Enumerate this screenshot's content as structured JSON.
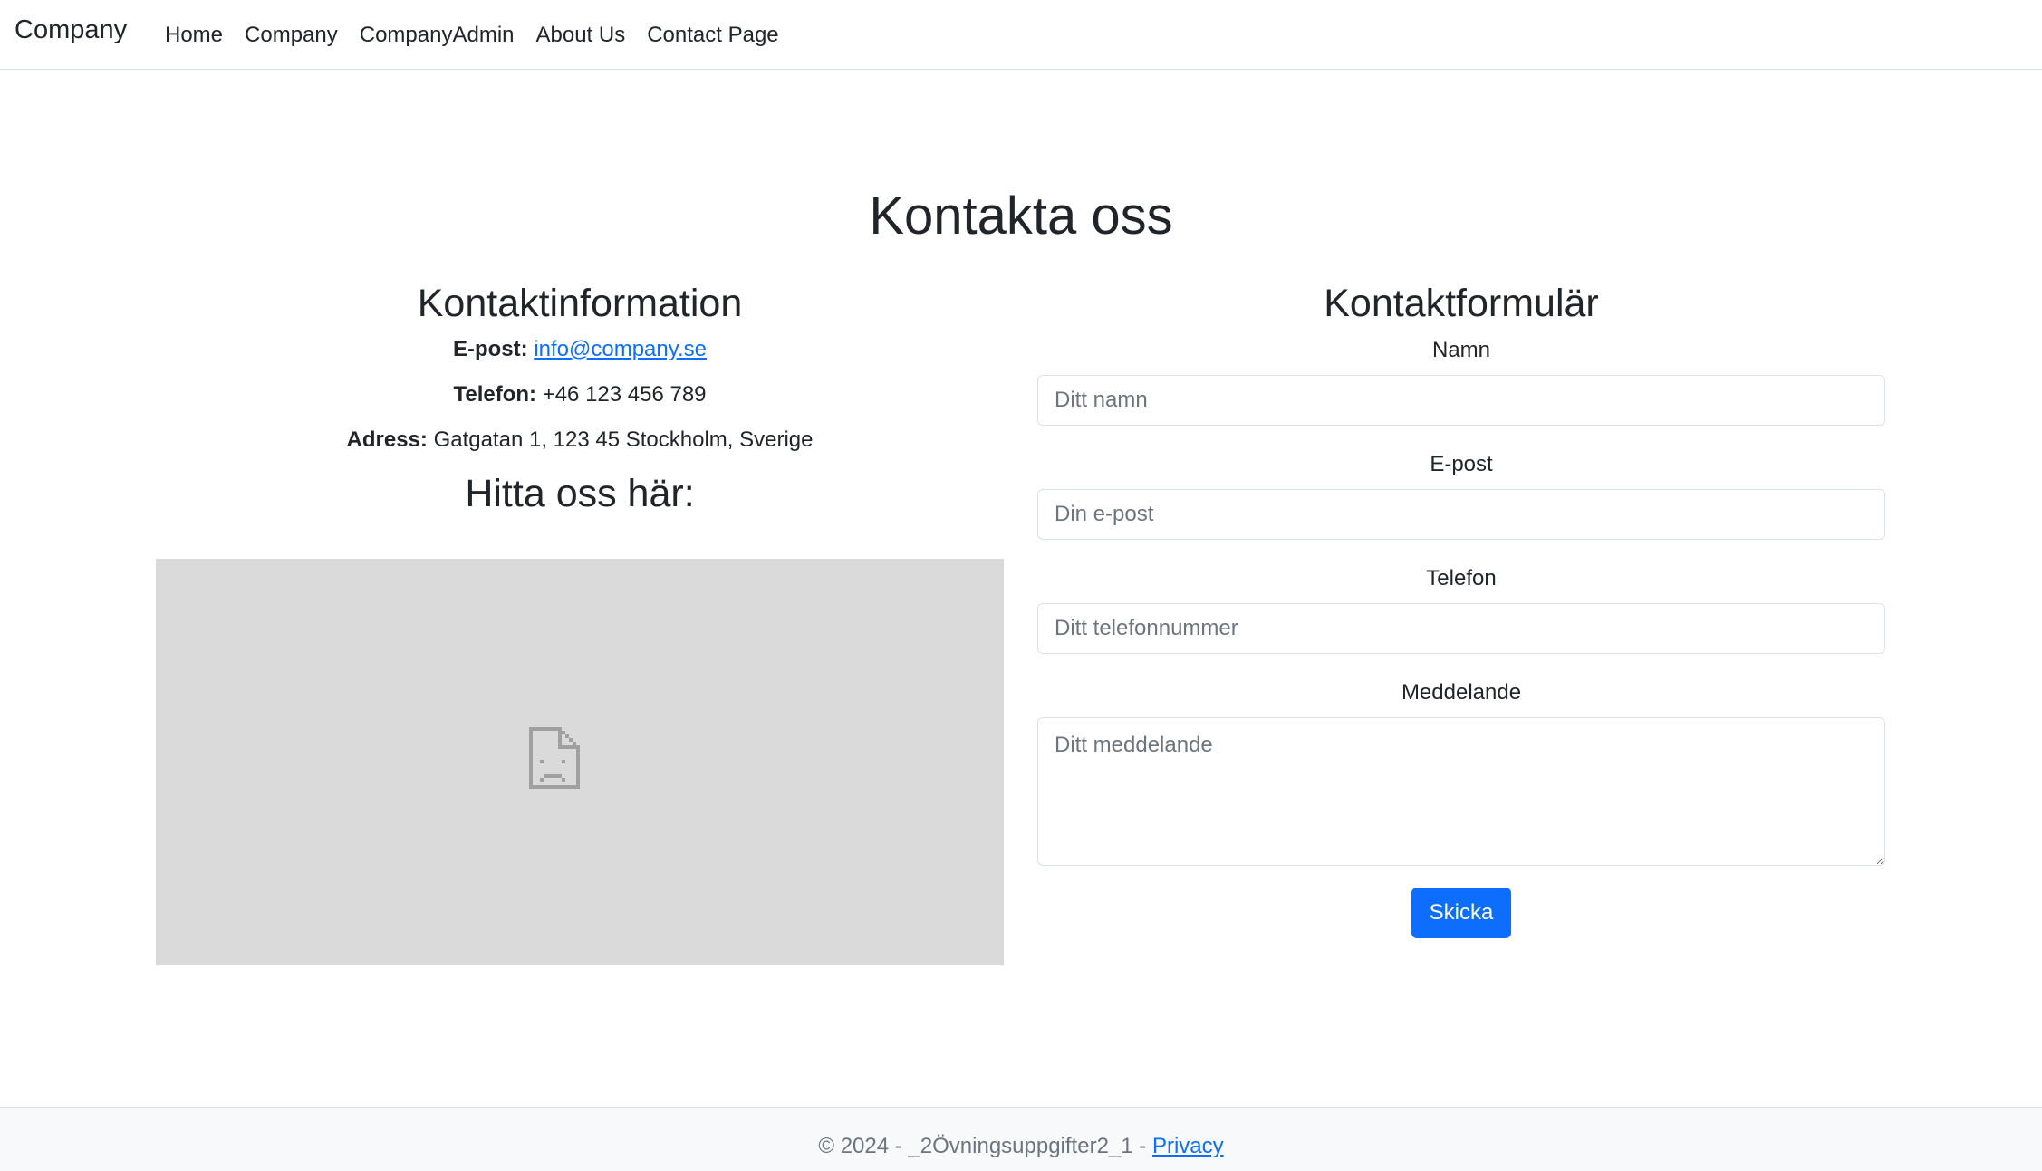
{
  "navbar": {
    "brand": "Company",
    "links": [
      "Home",
      "Company",
      "CompanyAdmin",
      "About Us",
      "Contact Page"
    ]
  },
  "page": {
    "title": "Kontakta oss"
  },
  "contact_info": {
    "heading": "Kontaktinformation",
    "email_label": "E-post:",
    "email_value": "info@company.se",
    "phone_label": "Telefon:",
    "phone_value": "+46 123 456 789",
    "address_label": "Adress:",
    "address_value": "Gatgatan 1, 123 45 Stockholm, Sverige",
    "map_heading": "Hitta oss här:",
    "map_icon": "broken-page-icon"
  },
  "form": {
    "heading": "Kontaktformulär",
    "name_label": "Namn",
    "name_placeholder": "Ditt namn",
    "email_label": "E-post",
    "email_placeholder": "Din e-post",
    "phone_label": "Telefon",
    "phone_placeholder": "Ditt telefonnummer",
    "message_label": "Meddelande",
    "message_placeholder": "Ditt meddelande",
    "submit_label": "Skicka"
  },
  "footer": {
    "text": "© 2024 - _2Övningsuppgifter2_1 -",
    "privacy_link": "Privacy"
  },
  "colors": {
    "primary": "#0d6efd",
    "map_background": "#dadada",
    "footer_background": "#f8f9fa"
  }
}
